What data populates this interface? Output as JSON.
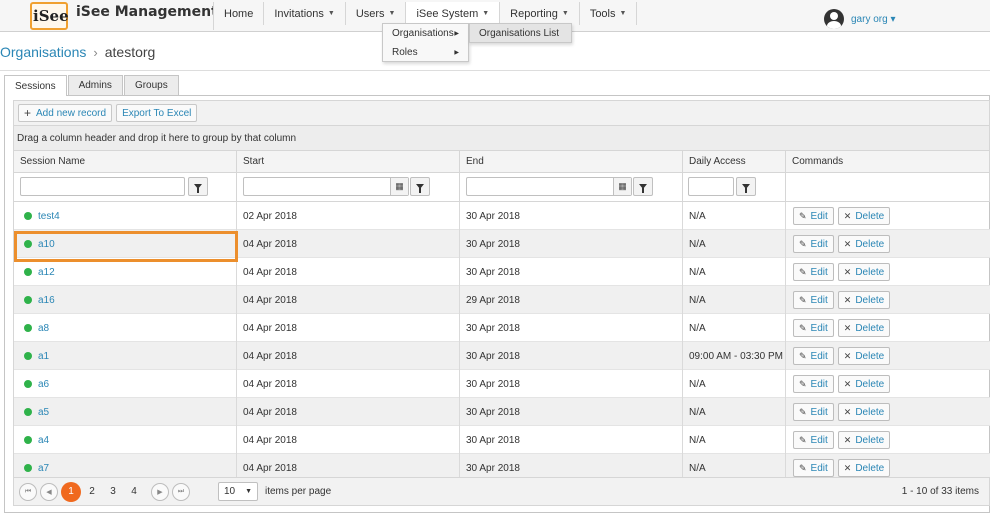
{
  "header": {
    "logo_text": "iSee",
    "app_title": "iSee Management",
    "nav": [
      {
        "label": "Home",
        "caret": ""
      },
      {
        "label": "Invitations",
        "caret": "▼"
      },
      {
        "label": "Users",
        "caret": "▼"
      },
      {
        "label": "iSee System",
        "caret": "▼"
      },
      {
        "label": "Reporting",
        "caret": "▼"
      },
      {
        "label": "Tools",
        "caret": "▼"
      }
    ],
    "user_name": "gary org ▾"
  },
  "menu": {
    "items": [
      {
        "label": "Organisations",
        "arrow": "▶"
      },
      {
        "label": "Roles",
        "arrow": "▶"
      }
    ],
    "submenu_item": "Organisations List"
  },
  "breadcrumb": {
    "link": "Organisations",
    "separator": "›",
    "current": "atestorg"
  },
  "tabs": [
    "Sessions",
    "Admins",
    "Groups"
  ],
  "toolbar": {
    "add_plus": "+",
    "add_label": "Add new record",
    "export_label": "Export To Excel"
  },
  "group_hint": "Drag a column header and drop it here to group by that column",
  "columns": [
    "Session Name",
    "Start",
    "End",
    "Daily Access",
    "Commands"
  ],
  "filter_calendar_glyph": "▦",
  "commands": {
    "edit_icon": "✎",
    "edit": "Edit",
    "delete_icon": "✕",
    "delete": "Delete"
  },
  "rows": [
    {
      "name": "test4",
      "start": "02 Apr 2018",
      "end": "30 Apr 2018",
      "access": "N/A"
    },
    {
      "name": "a10",
      "start": "04 Apr 2018",
      "end": "30 Apr 2018",
      "access": "N/A"
    },
    {
      "name": "a12",
      "start": "04 Apr 2018",
      "end": "30 Apr 2018",
      "access": "N/A"
    },
    {
      "name": "a16",
      "start": "04 Apr 2018",
      "end": "29 Apr 2018",
      "access": "N/A"
    },
    {
      "name": "a8",
      "start": "04 Apr 2018",
      "end": "30 Apr 2018",
      "access": "N/A"
    },
    {
      "name": "a1",
      "start": "04 Apr 2018",
      "end": "30 Apr 2018",
      "access": "09:00 AM - 03:30 PM"
    },
    {
      "name": "a6",
      "start": "04 Apr 2018",
      "end": "30 Apr 2018",
      "access": "N/A"
    },
    {
      "name": "a5",
      "start": "04 Apr 2018",
      "end": "30 Apr 2018",
      "access": "N/A"
    },
    {
      "name": "a4",
      "start": "04 Apr 2018",
      "end": "30 Apr 2018",
      "access": "N/A"
    },
    {
      "name": "a7",
      "start": "04 Apr 2018",
      "end": "30 Apr 2018",
      "access": "N/A"
    }
  ],
  "pager": {
    "first": "⏮",
    "prev": "◀",
    "next": "▶",
    "last": "⏭",
    "pages": [
      "1",
      "2",
      "3",
      "4"
    ],
    "current_page": "1",
    "page_size": "10",
    "page_size_caret": "▼",
    "page_size_label": "items per page",
    "info": "1 - 10 of 33 items"
  },
  "colors": {
    "accent": "#2a86b5",
    "active_page": "#f0691e",
    "highlight": "#ec8f2d",
    "status_dot": "#2fb24a"
  }
}
